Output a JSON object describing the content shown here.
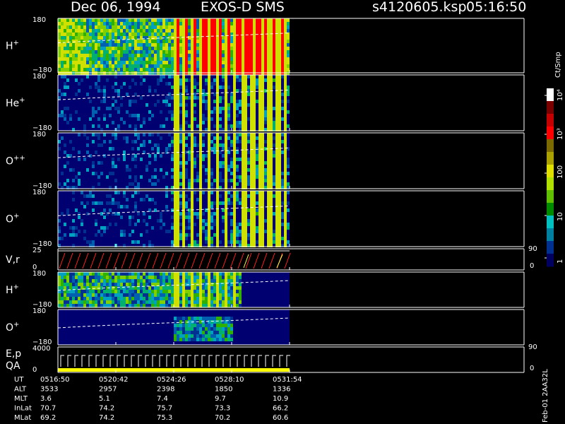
{
  "header": {
    "date": "Dec 06, 1994",
    "instrument": "EXOS-D SMS",
    "file": "s4120605.ksp",
    "time": "05:16:50"
  },
  "colorbar": {
    "unit": "Ct/Smp",
    "tick_labels": [
      "10⁴",
      "10³",
      "100",
      "10",
      "1"
    ],
    "colors": [
      "#ffffff",
      "#7a0000",
      "#c40000",
      "#ff0000",
      "#7a6a00",
      "#aaa000",
      "#e0e000",
      "#b0e000",
      "#60c000",
      "#008a00",
      "#00c0c0",
      "#0080a0",
      "#003090",
      "#000060"
    ]
  },
  "panels": [
    {
      "id": "h1",
      "label": "H",
      "sup": "+",
      "ytop": "180",
      "ybot": "−180",
      "kind": "h"
    },
    {
      "id": "he",
      "label": "He",
      "sup": "+",
      "ytop": "180",
      "ybot": "−180",
      "kind": "he"
    },
    {
      "id": "o2",
      "label": "O",
      "sup": "++",
      "ytop": "180",
      "ybot": "−180",
      "kind": "o2"
    },
    {
      "id": "o1",
      "label": "O",
      "sup": "+",
      "ytop": "180",
      "ybot": "−180",
      "kind": "o1"
    },
    {
      "id": "vr",
      "label": "V,r",
      "sup": "",
      "ytop": "25",
      "ybot": "0",
      "right_top": "90",
      "right_bot": "0",
      "kind": "line"
    },
    {
      "id": "h2",
      "label": "H",
      "sup": "+",
      "ytop": "180",
      "ybot": "−180",
      "kind": "h2"
    },
    {
      "id": "o3",
      "label": "O",
      "sup": "+",
      "ytop": "180",
      "ybot": "−180",
      "kind": "o3"
    },
    {
      "id": "ep",
      "label": "E,p",
      "label2": "QA",
      "sup": "",
      "ytop": "4000",
      "ybot": "0",
      "right_top": "90",
      "right_bot": "0",
      "kind": "steps"
    }
  ],
  "footer": {
    "rows": [
      {
        "name": "UT",
        "values": [
          "0516:50",
          "0520:42",
          "0524:26",
          "0528:10",
          "0531:54"
        ]
      },
      {
        "name": "ALT",
        "values": [
          "3533",
          "2957",
          "2398",
          "1850",
          "1336"
        ]
      },
      {
        "name": "MLT",
        "values": [
          "3.6",
          "5.1",
          "7.4",
          "9.7",
          "10.9"
        ]
      },
      {
        "name": "InLat",
        "values": [
          "70.7",
          "74.2",
          "75.7",
          "73.3",
          "66.2"
        ]
      },
      {
        "name": "MLat",
        "values": [
          "69.2",
          "74.2",
          "75.3",
          "70.2",
          "60.6"
        ]
      }
    ],
    "side_note": "Feb-01 2AA32L"
  },
  "chart_data": {
    "type": "heatmap",
    "title": "Dec 06, 1994   EXOS-D SMS",
    "xlabel": "UT",
    "x_ticks": [
      "0516:50",
      "0520:42",
      "0524:26",
      "0528:10",
      "0531:54"
    ],
    "ylim": [
      -180,
      180
    ],
    "series": [
      {
        "name": "H+"
      },
      {
        "name": "He+"
      },
      {
        "name": "O++"
      },
      {
        "name": "O+"
      },
      {
        "name": "V,r"
      },
      {
        "name": "H+"
      },
      {
        "name": "O+"
      },
      {
        "name": "E,p"
      }
    ],
    "colorscale": "log counts 1 to 10^4 (Ct/Smp)"
  }
}
